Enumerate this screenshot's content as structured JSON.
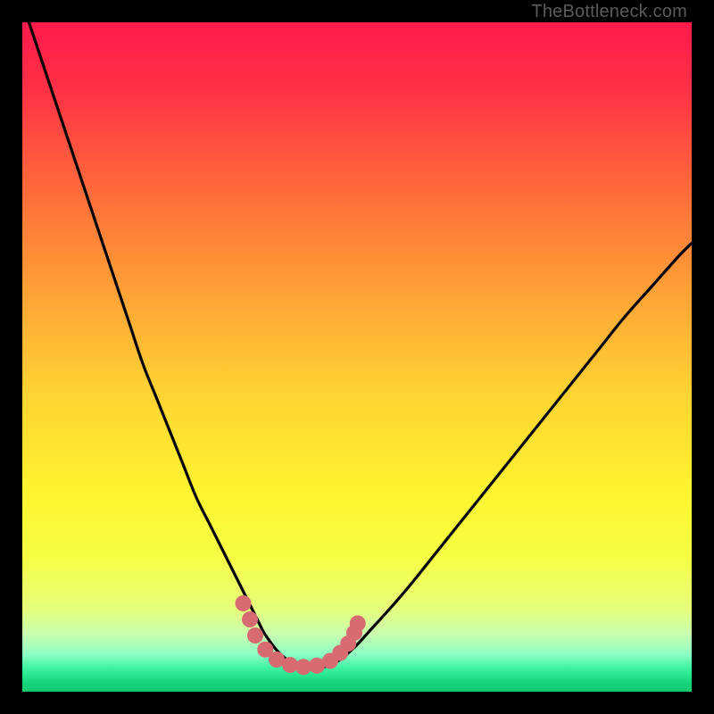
{
  "watermark": "TheBottleneck.com",
  "gradient_stops": [
    {
      "offset": 0.0,
      "color": "#ff1a4b"
    },
    {
      "offset": 0.1,
      "color": "#ff3146"
    },
    {
      "offset": 0.25,
      "color": "#ff6a3a"
    },
    {
      "offset": 0.4,
      "color": "#ffa136"
    },
    {
      "offset": 0.55,
      "color": "#ffd233"
    },
    {
      "offset": 0.7,
      "color": "#fff330"
    },
    {
      "offset": 0.8,
      "color": "#f6ff45"
    },
    {
      "offset": 0.875,
      "color": "#e6ff7a"
    },
    {
      "offset": 0.915,
      "color": "#c8ffb0"
    },
    {
      "offset": 0.945,
      "color": "#8bffc4"
    },
    {
      "offset": 0.965,
      "color": "#3cf2a0"
    },
    {
      "offset": 0.985,
      "color": "#18d87e"
    },
    {
      "offset": 1.0,
      "color": "#10c86f"
    }
  ],
  "chart_data": {
    "type": "line",
    "title": "",
    "xlabel": "",
    "ylabel": "",
    "xlim": [
      0,
      100
    ],
    "ylim": [
      0,
      100
    ],
    "series": [
      {
        "name": "curve",
        "x": [
          0,
          2,
          4,
          6,
          8,
          10,
          12,
          14,
          16,
          18,
          20,
          22,
          24,
          26,
          28,
          30,
          31,
          32,
          33,
          34,
          35,
          36,
          37,
          38,
          39,
          40,
          41,
          42,
          43,
          44,
          45,
          46,
          47,
          48,
          50,
          52,
          55,
          58,
          62,
          66,
          70,
          74,
          78,
          82,
          86,
          90,
          94,
          98,
          100
        ],
        "y": [
          103,
          97,
          91,
          85,
          79,
          73,
          67,
          61,
          55,
          49,
          44,
          39,
          34,
          29,
          25,
          21,
          19,
          17,
          15,
          13,
          11,
          9,
          7.5,
          6.2,
          5.2,
          4.5,
          4.0,
          3.7,
          3.6,
          3.6,
          3.7,
          4.0,
          4.5,
          5.2,
          7.0,
          9.2,
          12.5,
          16,
          21,
          26,
          31,
          36,
          41,
          46,
          51,
          56,
          60.5,
          65,
          67
        ]
      }
    ],
    "markers": {
      "name": "bottom-dots",
      "color": "#d86a72",
      "points": [
        {
          "x": 33.0,
          "y": 13.2
        },
        {
          "x": 34.0,
          "y": 10.8
        },
        {
          "x": 34.8,
          "y": 8.4
        },
        {
          "x": 36.3,
          "y": 6.3
        },
        {
          "x": 38.0,
          "y": 4.8
        },
        {
          "x": 40.0,
          "y": 4.0
        },
        {
          "x": 42.0,
          "y": 3.7
        },
        {
          "x": 44.0,
          "y": 3.9
        },
        {
          "x": 46.0,
          "y": 4.6
        },
        {
          "x": 47.5,
          "y": 5.8
        },
        {
          "x": 48.7,
          "y": 7.2
        },
        {
          "x": 49.6,
          "y": 8.8
        },
        {
          "x": 50.1,
          "y": 10.2
        }
      ]
    }
  }
}
